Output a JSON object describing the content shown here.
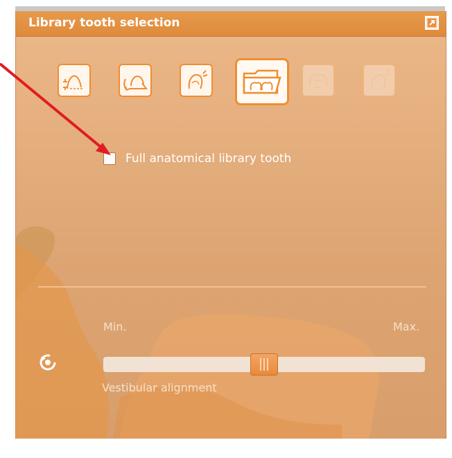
{
  "window": {
    "title": "Library tooth selection",
    "maximize_icon": "expand-arrow-icon"
  },
  "toolbar": {
    "buttons": [
      {
        "icon": "cervical-margin-icon",
        "state": "normal"
      },
      {
        "icon": "rotate-tooth-icon",
        "state": "normal"
      },
      {
        "icon": "tooth-adapt-icon",
        "state": "normal"
      },
      {
        "icon": "library-folder-icon",
        "state": "active"
      },
      {
        "icon": "tooth-connector-icon",
        "state": "disabled"
      },
      {
        "icon": "tooth-scale-icon",
        "state": "disabled"
      }
    ]
  },
  "checkbox": {
    "label": "Full anatomical library tooth",
    "checked": false
  },
  "slider": {
    "min_label": "Min.",
    "max_label": "Max.",
    "label": "Vestibular alignment",
    "value_fraction": 0.5,
    "reset_icon": "reset-rotate-icon"
  },
  "colors": {
    "title_bar": "#e2903f",
    "panel": "#dda573",
    "accent": "#f08d2e",
    "annotation_arrow": "#e01b24"
  }
}
